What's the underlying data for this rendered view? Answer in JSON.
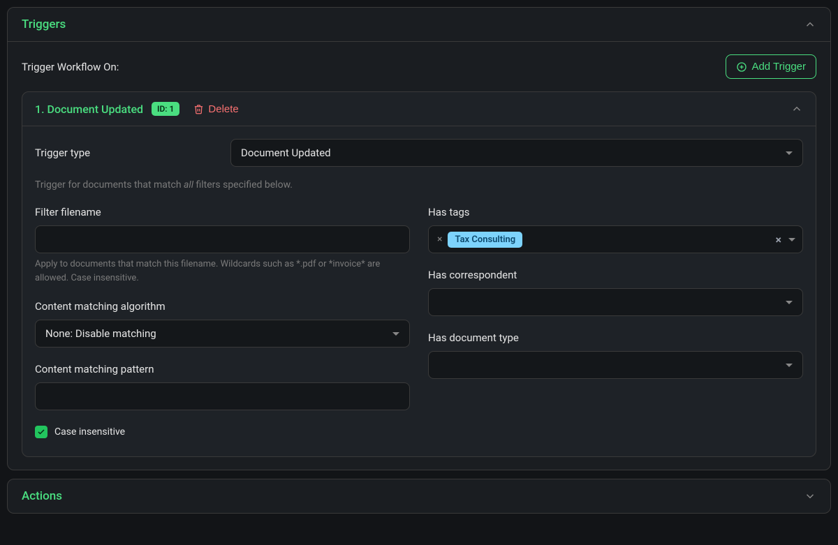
{
  "triggers_section": {
    "title": "Triggers",
    "subtitle": "Trigger Workflow On:",
    "add_button": "Add Trigger"
  },
  "trigger": {
    "title": "1. Document Updated",
    "badge": "ID: 1",
    "delete_label": "Delete",
    "type_label": "Trigger type",
    "type_value": "Document Updated",
    "help_prefix": "Trigger for documents that match ",
    "help_em": "all",
    "help_suffix": " filters specified below.",
    "filter_filename_label": "Filter filename",
    "filter_filename_value": "",
    "filter_filename_hint": "Apply to documents that match this filename. Wildcards such as *.pdf or *invoice* are allowed. Case insensitive.",
    "algorithm_label": "Content matching algorithm",
    "algorithm_value": "None: Disable matching",
    "pattern_label": "Content matching pattern",
    "pattern_value": "",
    "case_insensitive_label": "Case insensitive",
    "case_insensitive_checked": true,
    "has_tags_label": "Has tags",
    "tags": [
      {
        "label": "Tax Consulting",
        "color": "#7dd3fc"
      }
    ],
    "has_correspondent_label": "Has correspondent",
    "has_correspondent_value": "",
    "has_doctype_label": "Has document type",
    "has_doctype_value": ""
  },
  "actions_section": {
    "title": "Actions"
  }
}
